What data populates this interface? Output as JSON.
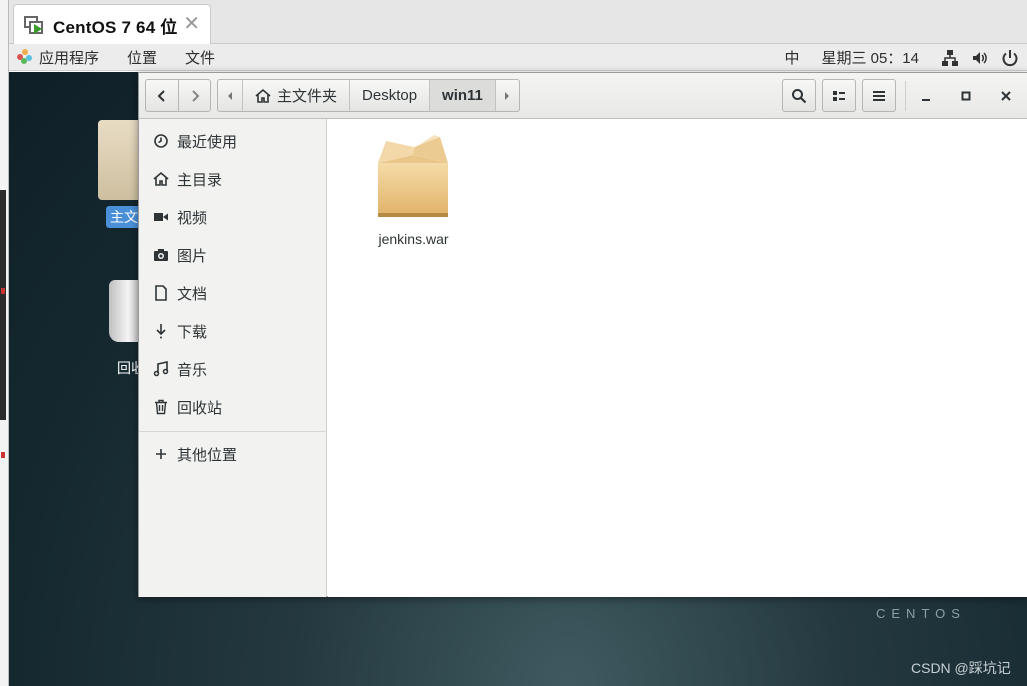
{
  "vm_tab": {
    "title": "CentOS 7 64 位",
    "close": "✕"
  },
  "topbar": {
    "menus": [
      "应用程序",
      "位置",
      "文件"
    ],
    "input_method": "中",
    "clock": "星期三 05：14"
  },
  "desktop": {
    "home_label": "主文件夹",
    "trash_label": "回收站",
    "brand": "CENTOS",
    "watermark": "CSDN @踩坑记"
  },
  "window": {
    "path": [
      "主文件夹",
      "Desktop",
      "win11"
    ],
    "sidebar": [
      {
        "label": "最近使用",
        "icon": "clock-icon"
      },
      {
        "label": "主目录",
        "icon": "home-icon"
      },
      {
        "label": "视频",
        "icon": "video-icon"
      },
      {
        "label": "图片",
        "icon": "camera-icon"
      },
      {
        "label": "文档",
        "icon": "document-icon"
      },
      {
        "label": "下载",
        "icon": "download-icon"
      },
      {
        "label": "音乐",
        "icon": "music-icon"
      },
      {
        "label": "回收站",
        "icon": "trash-icon"
      }
    ],
    "other_locations": "其他位置",
    "files": [
      {
        "name": "jenkins.war",
        "icon": "package-icon"
      }
    ]
  }
}
